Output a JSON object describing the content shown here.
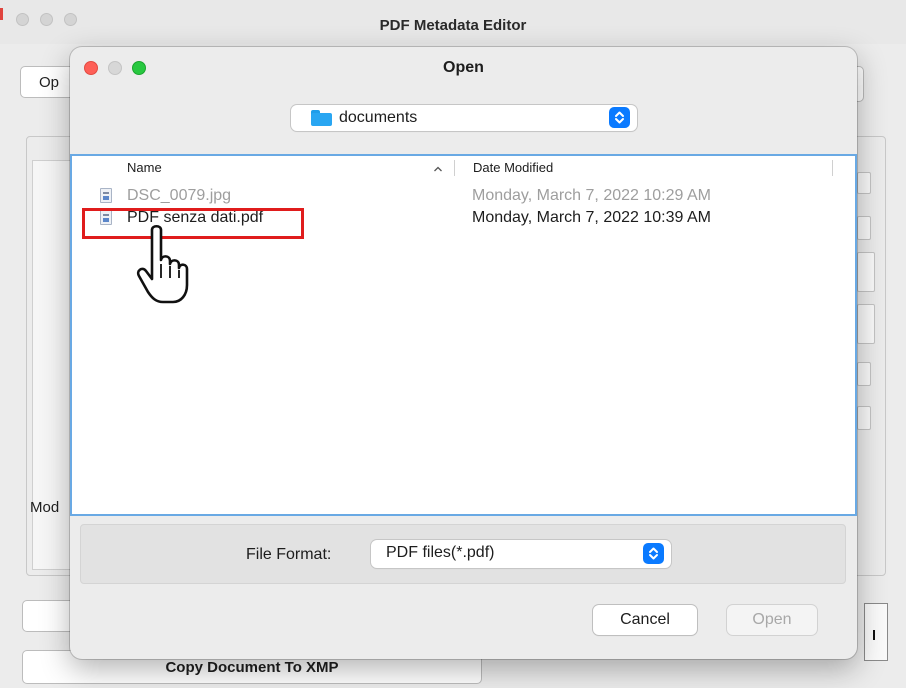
{
  "app": {
    "window_title": "PDF Metadata Editor",
    "open_button_partial": "Op",
    "mod_label_partial": "Mod",
    "copy_button_label": "Copy Document To XMP"
  },
  "dialog": {
    "title": "Open",
    "location": "documents",
    "columns": {
      "name": "Name",
      "date_modified": "Date Modified"
    },
    "files": [
      {
        "name": "DSC_0079.jpg",
        "date": "Monday, March 7, 2022 10:29 AM",
        "enabled": false
      },
      {
        "name": "PDF senza dati.pdf",
        "date": "Monday, March 7, 2022 10:39 AM",
        "enabled": true,
        "highlighted": true
      }
    ],
    "file_format_label": "File Format:",
    "file_format_value": "PDF files(*.pdf)",
    "cancel_label": "Cancel",
    "open_label": "Open"
  },
  "icons": {
    "location_icon": "folder-icon",
    "file_icon": "document-file-icon",
    "cursor": "pointing-hand-cursor-icon"
  },
  "colors": {
    "accent": "#0a7aff",
    "highlight_box": "#e01c1c",
    "list_focus_ring": "#69a9e4"
  }
}
